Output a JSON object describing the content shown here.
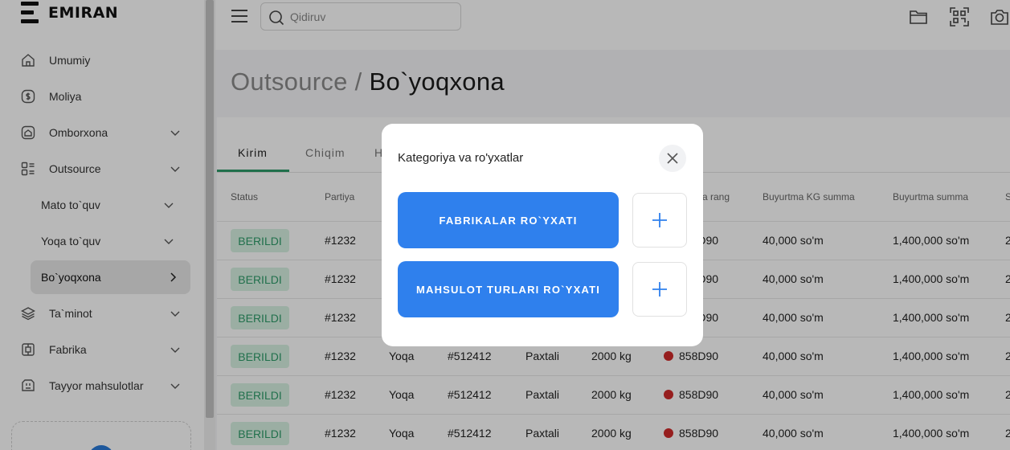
{
  "app": {
    "name": "EMIRAN"
  },
  "sidebar": {
    "items": [
      {
        "label": "Umumiy",
        "icon": "home-icon"
      },
      {
        "label": "Moliya",
        "icon": "dollar-icon"
      },
      {
        "label": "Omborxona",
        "icon": "warehouse-icon"
      },
      {
        "label": "Outsource",
        "icon": "grid-icon"
      },
      {
        "label": "Mato to`quv"
      },
      {
        "label": "Yoqa to`quv"
      },
      {
        "label": "Bo`yoqxona"
      },
      {
        "label": "Ta`minot",
        "icon": "layers-icon"
      },
      {
        "label": "Fabrika",
        "icon": "factory-icon"
      },
      {
        "label": "Tayyor mahsulotlar",
        "icon": "shirt-icon"
      }
    ]
  },
  "header": {
    "search_placeholder": "Qidiruv",
    "icons": [
      "folder-icon",
      "qr-scan-icon",
      "camera-icon"
    ]
  },
  "page": {
    "title_parent": "Outsource",
    "title_separator": " / ",
    "title_current": "Bo`yoqxona"
  },
  "tabs": [
    "Kirim",
    "Chiqim",
    "H"
  ],
  "table": {
    "headers": [
      "Status",
      "Partiya",
      "a rang",
      "Buyurtma KG summa",
      "Buyurtma summa",
      "S"
    ],
    "rows": [
      {
        "status": "BERILDI",
        "partiya": "#1232",
        "col3": "",
        "col4": "",
        "col5": "",
        "col6": "",
        "rang": "858D90",
        "kg_summa": "40,000 so'm",
        "summa": "1,400,000 so'm",
        "last": "2"
      },
      {
        "status": "BERILDI",
        "partiya": "#1232",
        "col3": "",
        "col4": "",
        "col5": "",
        "col6": "",
        "rang": "858D90",
        "kg_summa": "40,000 so'm",
        "summa": "1,400,000 so'm",
        "last": "2"
      },
      {
        "status": "BERILDI",
        "partiya": "#1232",
        "col3": "",
        "col4": "",
        "col5": "",
        "col6": "",
        "rang": "858D90",
        "kg_summa": "40,000 so'm",
        "summa": "1,400,000 so'm",
        "last": "2"
      },
      {
        "status": "BERILDI",
        "partiya": "#1232",
        "col3": "Yoqa",
        "col4": "#512412",
        "col5": "Paxtali",
        "col6": "2000 kg",
        "rang": "858D90",
        "kg_summa": "40,000 so'm",
        "summa": "1,400,000 so'm",
        "last": "2"
      },
      {
        "status": "BERILDI",
        "partiya": "#1232",
        "col3": "Yoqa",
        "col4": "#512412",
        "col5": "Paxtali",
        "col6": "2000 kg",
        "rang": "858D90",
        "kg_summa": "40,000 so'm",
        "summa": "1,400,000 so'm",
        "last": "2"
      },
      {
        "status": "BERILDI",
        "partiya": "#1232",
        "col3": "Yoqa",
        "col4": "#512412",
        "col5": "Paxtali",
        "col6": "2000 kg",
        "rang": "858D90",
        "kg_summa": "40,000 so'm",
        "summa": "1,400,000 so'm",
        "last": "2"
      }
    ]
  },
  "modal": {
    "title": "Kategoriya va ro'yxatlar",
    "buttons": [
      {
        "label": "FABRIKALAR RO`YXATI"
      },
      {
        "label": "MAHSULOT TURLARI RO`YXATI"
      }
    ]
  },
  "colors": {
    "primary": "#2f80ed",
    "status_green": "#2e9c6a",
    "status_bg": "#d7f2e2",
    "rang_dot": "#d02a2a"
  }
}
